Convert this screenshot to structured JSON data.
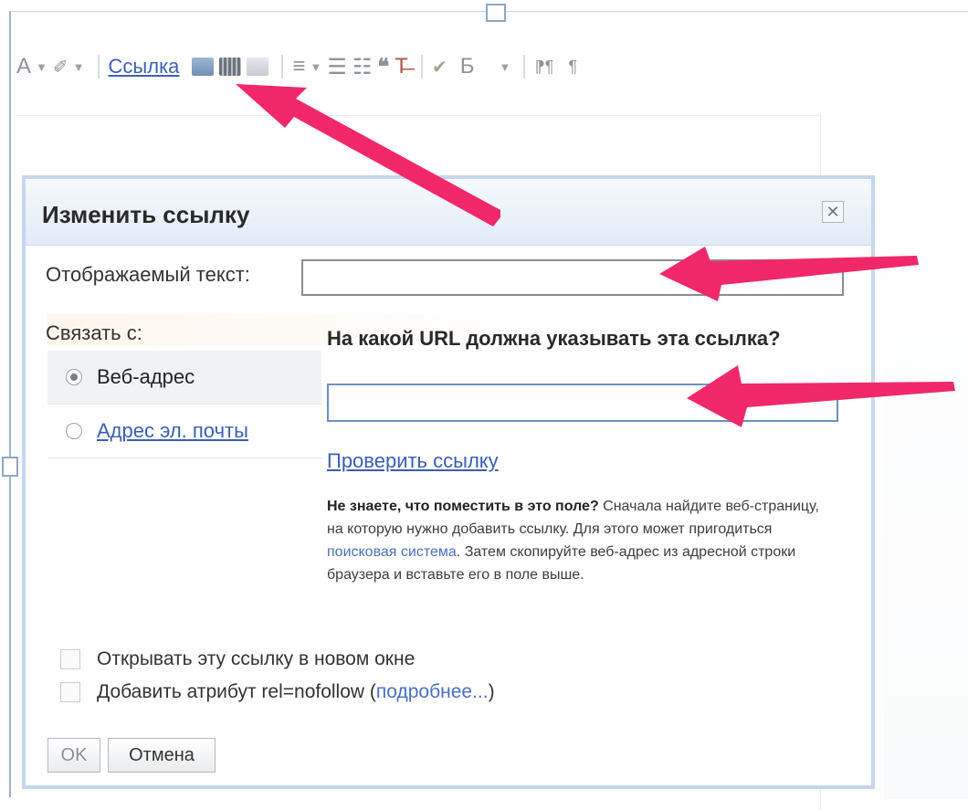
{
  "toolbar": {
    "text_color_label": "A",
    "highlight_label": "✐",
    "link_label": "Ссылка",
    "bold_label": "Б"
  },
  "dialog": {
    "title": "Изменить ссылку",
    "close_glyph": "✕",
    "display_text_label": "Отображаемый текст:",
    "display_text_value": "",
    "link_with_label": "Связать с:",
    "link_types": [
      {
        "label": "Веб-адрес",
        "selected": true
      },
      {
        "label": "Адрес эл. почты",
        "selected": false
      }
    ],
    "url_prompt": "На какой URL должна указывать эта ссылка?",
    "url_value": "",
    "check_link_label": "Проверить ссылку",
    "help": {
      "bold": "Не знаете, что поместить в это поле?",
      "text_1": " Сначала найдите веб-страницу, на которую нужно добавить ссылку. Для этого может пригодиться ",
      "link": "поисковая система",
      "text_2": ". Затем скопируйте веб-адрес из адресной строки браузера и вставьте его в поле выше."
    },
    "open_new_window_label": "Открывать эту ссылку в новом окне",
    "nofollow_label": "Добавить атрибут rel=nofollow (",
    "nofollow_link": "подробнее...",
    "nofollow_close": ")",
    "ok_label": "OK",
    "cancel_label": "Отмена"
  },
  "colors": {
    "accent_arrow": "#f0286a",
    "link_blue": "#3b5db5",
    "dialog_border": "#c4d7ee"
  }
}
